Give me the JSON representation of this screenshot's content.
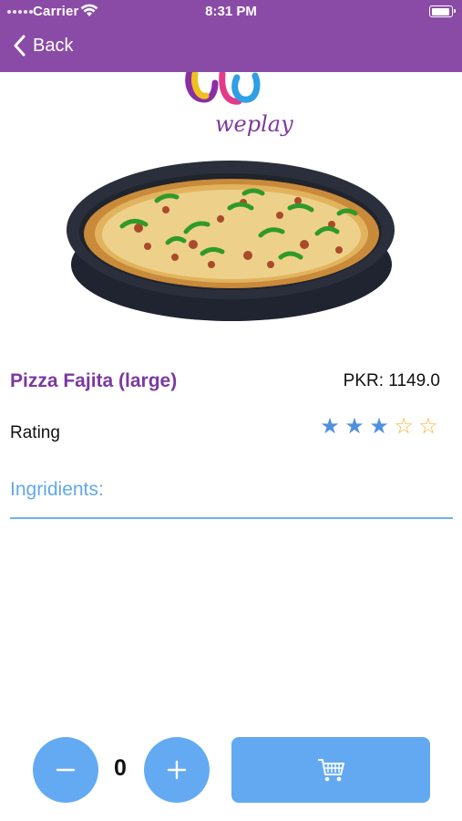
{
  "status_bar": {
    "carrier": "Carrier",
    "time": "8:31 PM",
    "battery_level": 0.95
  },
  "header": {
    "back_label": "Back",
    "colors": {
      "bar": "#8a4ba6",
      "text": "#ffffff"
    }
  },
  "logo": {
    "text": "weplay"
  },
  "product": {
    "name": "Pizza Fajita (large)",
    "price": "PKR: 1149.0",
    "rating_label": "Rating",
    "rating": 3,
    "rating_max": 5,
    "ingredients_label": "Ingridients:"
  },
  "cart": {
    "quantity": "0"
  },
  "icons": [
    "back-chevron-icon",
    "wifi-icon",
    "battery-icon",
    "minus-icon",
    "plus-icon",
    "cart-icon"
  ],
  "colors": {
    "accent_blue": "#64aaf3",
    "title_purple": "#7a3aa0",
    "star_filled": "#4f91e0",
    "star_empty": "#f3b63c"
  }
}
